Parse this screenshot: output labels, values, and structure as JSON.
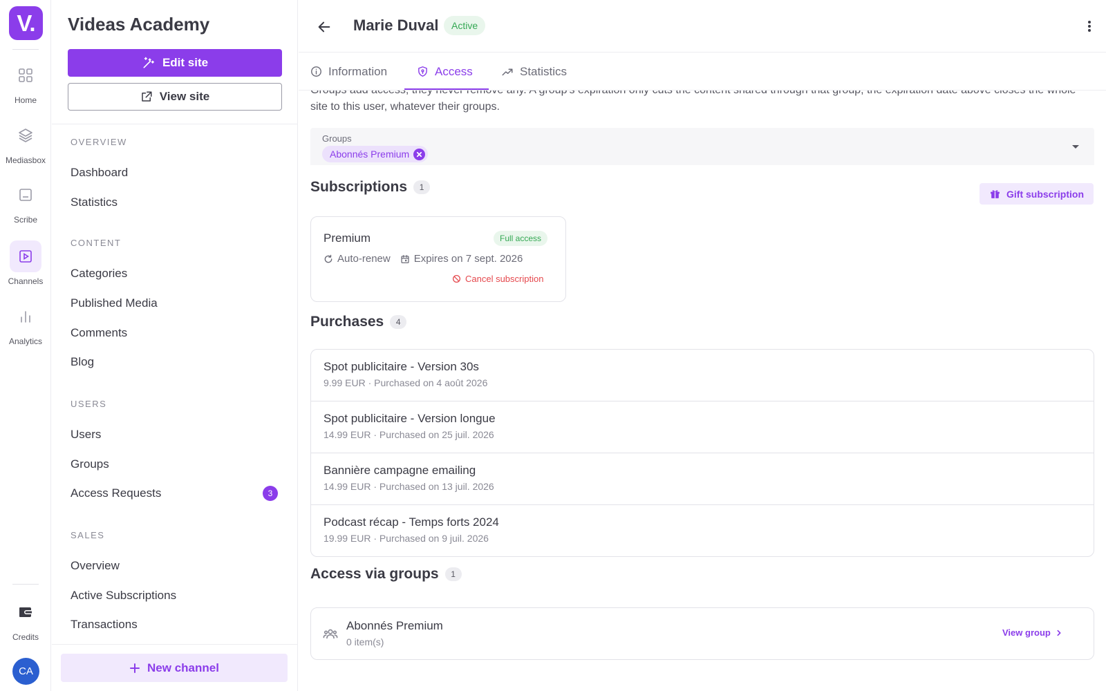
{
  "colors": {
    "accent": "#8b3dea",
    "accent_soft": "#f1e9fd",
    "success": "#34a853",
    "danger": "#e5484d",
    "avatar": "#2b5fd0"
  },
  "rail": {
    "logo": "V.",
    "items": [
      {
        "label": "Home",
        "icon": "grid-icon"
      },
      {
        "label": "Mediasbox",
        "icon": "layers-icon"
      },
      {
        "label": "Scribe",
        "icon": "document-icon"
      },
      {
        "label": "Channels",
        "icon": "play-square-icon",
        "active": true
      },
      {
        "label": "Analytics",
        "icon": "bar-chart-icon"
      }
    ],
    "credits_label": "Credits",
    "avatar_initials": "CA"
  },
  "sidebar": {
    "site_title": "Videas Academy",
    "edit_site_label": "Edit site",
    "view_site_label": "View site",
    "sections": [
      {
        "heading": "OVERVIEW",
        "items": [
          "Dashboard",
          "Statistics"
        ]
      },
      {
        "heading": "CONTENT",
        "items": [
          "Categories",
          "Published Media",
          "Comments",
          "Blog"
        ]
      },
      {
        "heading": "USERS",
        "items": [
          "Users",
          "Groups",
          "Access Requests"
        ]
      },
      {
        "heading": "SALES",
        "items": [
          "Overview",
          "Active Subscriptions",
          "Transactions"
        ]
      }
    ],
    "access_requests_count": "3",
    "new_channel_label": "New channel"
  },
  "header": {
    "user_name": "Marie Duval",
    "status": "Active"
  },
  "tabs": [
    {
      "label": "Information",
      "icon": "info-icon"
    },
    {
      "label": "Access",
      "icon": "shield-icon",
      "active": true
    },
    {
      "label": "Statistics",
      "icon": "trend-icon"
    }
  ],
  "access": {
    "intro_text": "Groups add access, they never remove any. A group's expiration only cuts the content shared through that group; the expiration date above closes the whole site to this user, whatever their groups.",
    "groups_label": "Groups",
    "selected_group": "Abonnés Premium",
    "subscriptions": {
      "title": "Subscriptions",
      "count": "1",
      "gift_label": "Gift subscription",
      "items": [
        {
          "name": "Premium",
          "badge": "Full access",
          "renew": "Auto-renew",
          "expires": "Expires on 7 sept. 2026",
          "cancel_label": "Cancel subscription"
        }
      ]
    },
    "purchases": {
      "title": "Purchases",
      "count": "4",
      "items": [
        {
          "title": "Spot publicitaire - Version 30s",
          "meta": "9.99 EUR · Purchased on 4 août 2026"
        },
        {
          "title": "Spot publicitaire - Version longue",
          "meta": "14.99 EUR · Purchased on 25 juil. 2026"
        },
        {
          "title": "Bannière campagne emailing",
          "meta": "14.99 EUR · Purchased on 13 juil. 2026"
        },
        {
          "title": "Podcast récap - Temps forts 2024",
          "meta": "19.99 EUR · Purchased on 9 juil. 2026"
        }
      ]
    },
    "access_groups": {
      "title": "Access via groups",
      "count": "1",
      "items": [
        {
          "name": "Abonnés Premium",
          "count": "0 item(s)",
          "action": "View group"
        }
      ]
    }
  }
}
